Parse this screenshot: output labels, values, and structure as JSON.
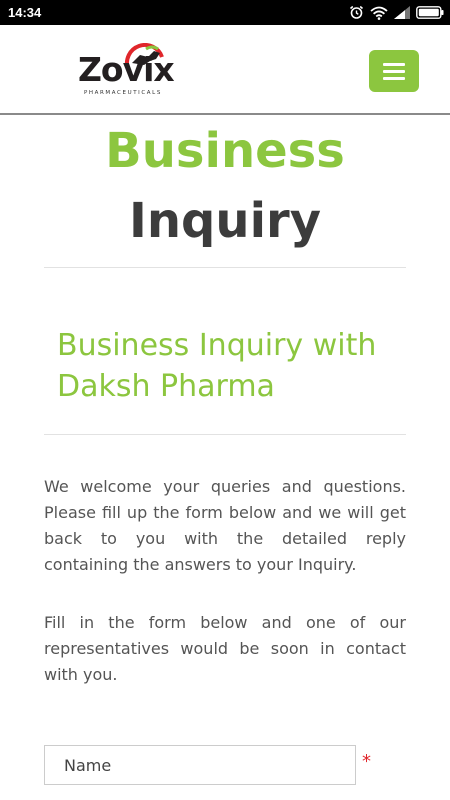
{
  "status_bar": {
    "time": "14:34",
    "icons": [
      "alarm-icon",
      "wifi-icon",
      "signal-icon",
      "battery-icon"
    ],
    "color": "#000000"
  },
  "header": {
    "logo": {
      "wordmark": "Zovix",
      "tagline": "PHARMACEUTICALS",
      "brand_colors": [
        "#e0262b",
        "#8cc63f",
        "#231f20"
      ]
    },
    "menu_button": {
      "icon": "hamburger-icon",
      "color": "#8cc63f"
    }
  },
  "page": {
    "title_line1": "Business",
    "title_line2": "Inquiry",
    "subtitle": "Business Inquiry with Daksh Pharma",
    "intro_paragraph": "We welcome your queries and questions. Please fill up the form below and we will get back to you with the detailed reply containing the answers to your Inquiry.",
    "form_paragraph": "Fill in the form below and one of our representatives would be soon in contact with you.",
    "accent_color": "#8cc63f",
    "title_color": "#3c3c3c"
  },
  "form": {
    "name_field": {
      "placeholder": "Name",
      "value": "",
      "required_marker": "*"
    }
  }
}
